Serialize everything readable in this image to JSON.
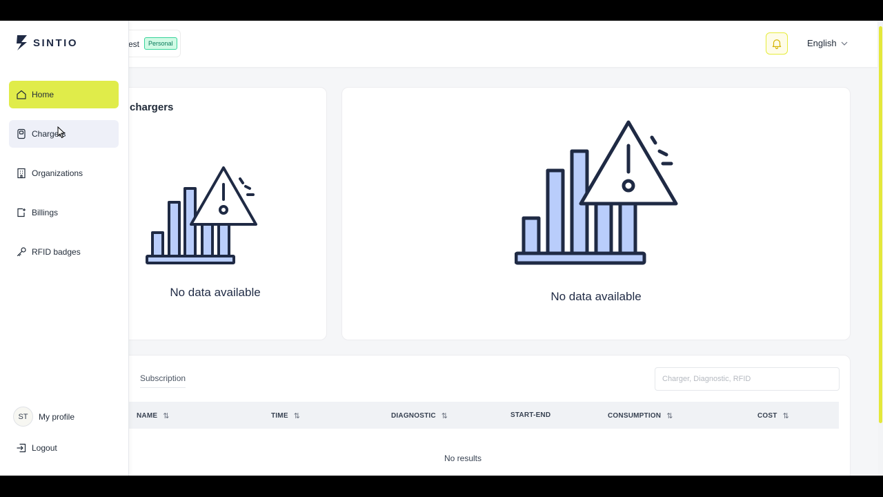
{
  "header": {
    "org_name": "est",
    "org_badge": "Personal",
    "language": "English"
  },
  "sidebar": {
    "logo_text": "SINTIO",
    "items": [
      {
        "label": "Home",
        "icon": "home-icon",
        "state": "active"
      },
      {
        "label": "Chargers",
        "icon": "charger-icon",
        "state": "hover"
      },
      {
        "label": "Organizations",
        "icon": "building-icon",
        "state": "normal"
      },
      {
        "label": "Billings",
        "icon": "billing-icon",
        "state": "normal"
      },
      {
        "label": "RFID badges",
        "icon": "key-icon",
        "state": "normal"
      }
    ],
    "profile_initials": "ST",
    "profile_label": "My profile",
    "logout_label": "Logout"
  },
  "cards": {
    "chargers_title": "chargers",
    "nodata_left": "No data available",
    "nodata_right": "No data available"
  },
  "sessions": {
    "tab_subscription": "Subscription",
    "search_placeholder": "Charger, Diagnostic, RFID",
    "columns": [
      {
        "label": "NAME",
        "sortable": true
      },
      {
        "label": "TIME",
        "sortable": true
      },
      {
        "label": "DIAGNOSTIC",
        "sortable": true
      },
      {
        "label": "START-END",
        "sortable": false
      },
      {
        "label": "CONSUMPTION",
        "sortable": true
      },
      {
        "label": "COST",
        "sortable": true
      }
    ],
    "empty_text": "No results",
    "sort_icon": "⇅"
  },
  "colors": {
    "accent": "#e0ec4a",
    "navy": "#1f2a44",
    "bar_fill": "#b9cdfb"
  }
}
